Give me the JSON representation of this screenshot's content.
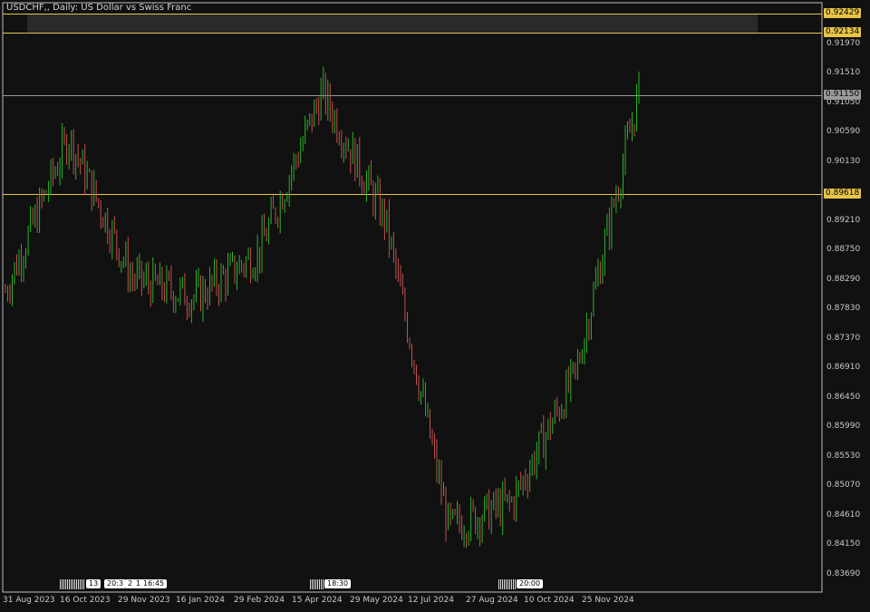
{
  "header": {
    "title": "USDCHF,, Daily:  US Dollar vs Swiss Franc"
  },
  "colors": {
    "background": "#111111",
    "bull": "#2bb32b",
    "bear": "#c0524f",
    "level": "#e8c547",
    "grid_frame": "#c0c0c0"
  },
  "axis": {
    "price_ticks": [
      "0.91970",
      "0.91510",
      "0.91050",
      "0.90590",
      "0.90130",
      "0.89210",
      "0.88750",
      "0.88290",
      "0.87830",
      "0.87370",
      "0.86910",
      "0.86450",
      "0.85990",
      "0.85530",
      "0.85070",
      "0.84610",
      "0.84150",
      "0.83690"
    ],
    "date_ticks": [
      "31 Aug 2023",
      "16 Oct 2023",
      "29 Nov 2023",
      "16 Jan 2024",
      "29 Feb 2024",
      "15 Apr 2024",
      "29 May 2024",
      "12 Jul 2024",
      "27 Aug 2024",
      "10 Oct 2024",
      "25 Nov 2024"
    ]
  },
  "levels": [
    {
      "label": "0.92429",
      "value": 0.92429,
      "style": "highlight"
    },
    {
      "label": "0.92134",
      "value": 0.92134,
      "style": "highlight"
    },
    {
      "label": "0.91150",
      "value": 0.9115,
      "style": "current"
    },
    {
      "label": "0.89618",
      "value": 0.89618,
      "style": "highlight"
    }
  ],
  "session_tags": [
    "13",
    "20:3",
    "2",
    "1",
    "16:45",
    "18:30",
    "20:00"
  ],
  "chart_data": {
    "type": "line",
    "title": "USDCHF,, Daily:  US Dollar vs Swiss Franc",
    "xlabel": "",
    "ylabel": "",
    "ylim": [
      0.834,
      0.926
    ],
    "x": [
      "31 Aug 2023",
      "16 Oct 2023",
      "29 Nov 2023",
      "16 Jan 2024",
      "29 Feb 2024",
      "15 Apr 2024",
      "29 May 2024",
      "12 Jul 2024",
      "27 Aug 2024",
      "10 Oct 2024",
      "25 Nov 2024"
    ],
    "series": [
      {
        "name": "",
        "values": [
          0.881,
          0.905,
          0.883,
          0.88,
          0.887,
          0.912,
          0.892,
          0.844,
          0.848,
          0.868,
          0.912
        ]
      }
    ]
  }
}
